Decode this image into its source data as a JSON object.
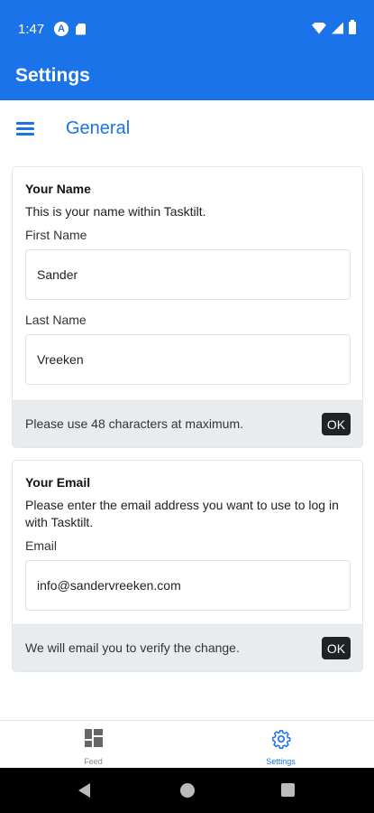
{
  "status_bar": {
    "time": "1:47",
    "left_icons": [
      "a-icon",
      "sd-card-icon"
    ],
    "right_icons": [
      "wifi-icon",
      "signal-icon",
      "battery-icon"
    ]
  },
  "app_bar": {
    "title": "Settings"
  },
  "section": {
    "title": "General",
    "menu_icon": "hamburger-menu-icon"
  },
  "name_card": {
    "heading": "Your Name",
    "description": "This is your name within Tasktilt.",
    "first_name_label": "First Name",
    "first_name_value": "Sander",
    "last_name_label": "Last Name",
    "last_name_value": "Vreeken",
    "footer_text": "Please use 48 characters at maximum.",
    "ok_label": "OK"
  },
  "email_card": {
    "heading": "Your Email",
    "description": "Please enter the email address you want to use to log in with Tasktilt.",
    "email_label": "Email",
    "email_value": "info@sandervreeken.com",
    "footer_text": "We will email you to verify the change.",
    "ok_label": "OK"
  },
  "bottom_nav": {
    "items": [
      {
        "label": "Feed",
        "icon": "dashboard-icon",
        "active": false
      },
      {
        "label": "Settings",
        "icon": "gear-icon",
        "active": true
      }
    ]
  },
  "colors": {
    "primary": "#1a73e8",
    "button_dark": "#1e2328",
    "footer_bg": "#e9ecef",
    "inactive": "#888888"
  }
}
